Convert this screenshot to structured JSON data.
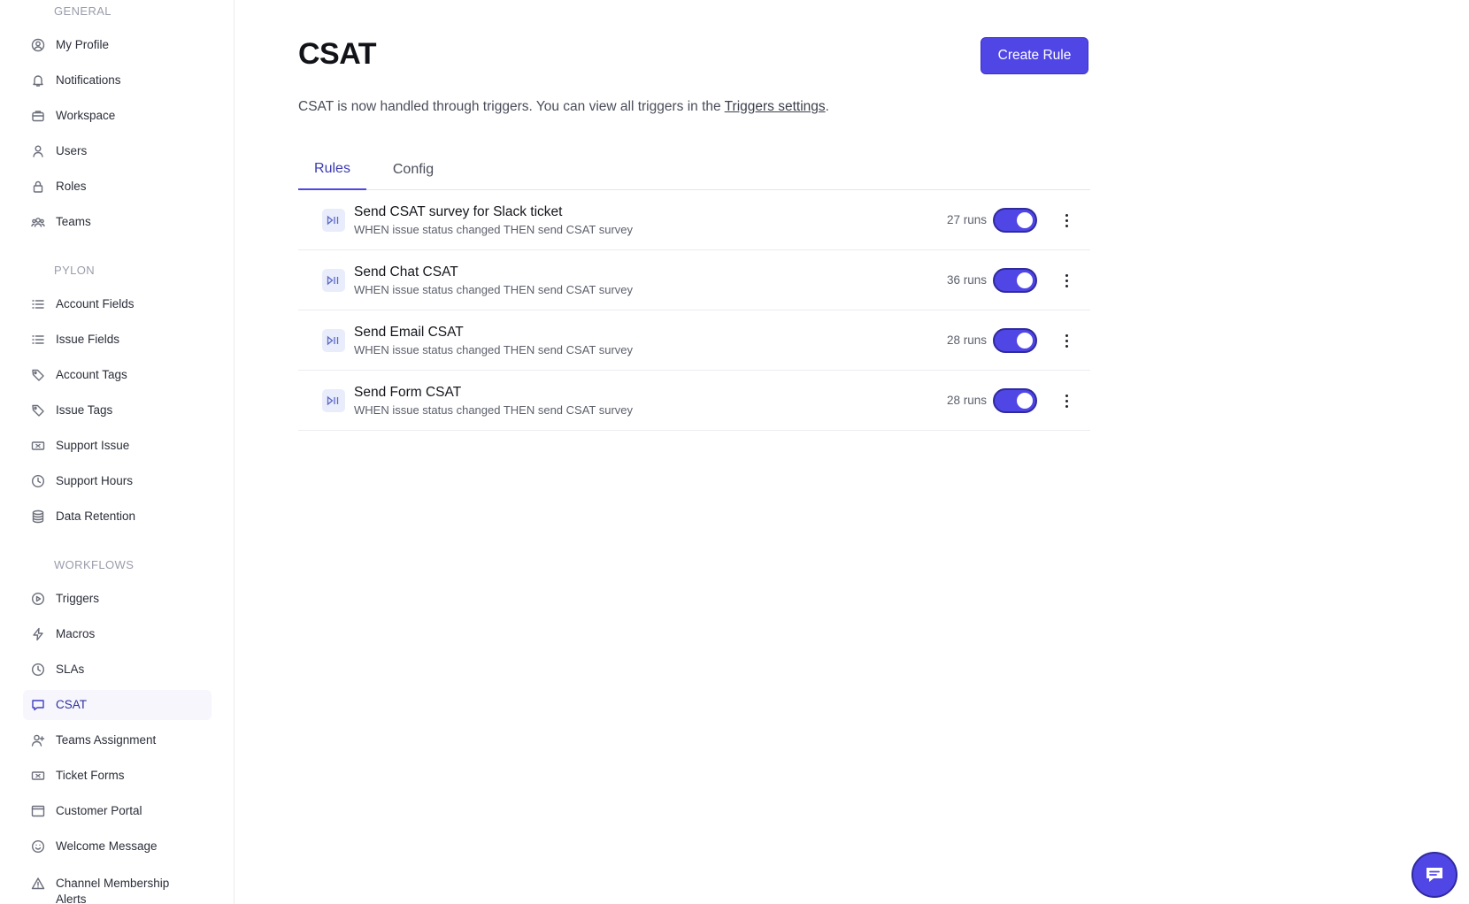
{
  "sidebar": {
    "sections": {
      "general": "GENERAL",
      "pylon": "PYLON",
      "workflows": "WORKFLOWS"
    },
    "items": [
      {
        "label": "My Profile",
        "icon": "user-circle-icon"
      },
      {
        "label": "Notifications",
        "icon": "bell-icon"
      },
      {
        "label": "Workspace",
        "icon": "briefcase-icon"
      },
      {
        "label": "Users",
        "icon": "user-icon"
      },
      {
        "label": "Roles",
        "icon": "lock-icon"
      },
      {
        "label": "Teams",
        "icon": "users-icon"
      },
      {
        "label": "Account Fields",
        "icon": "list-icon"
      },
      {
        "label": "Issue Fields",
        "icon": "list-icon"
      },
      {
        "label": "Account Tags",
        "icon": "tag-icon"
      },
      {
        "label": "Issue Tags",
        "icon": "tag-icon"
      },
      {
        "label": "Support Issue",
        "icon": "ticket-icon"
      },
      {
        "label": "Support Hours",
        "icon": "clock-icon"
      },
      {
        "label": "Data Retention",
        "icon": "database-icon"
      },
      {
        "label": "Triggers",
        "icon": "play-circle-icon"
      },
      {
        "label": "Macros",
        "icon": "bolt-icon"
      },
      {
        "label": "SLAs",
        "icon": "clock-icon"
      },
      {
        "label": "CSAT",
        "icon": "message-icon",
        "active": true
      },
      {
        "label": "Teams Assignment",
        "icon": "user-plus-icon"
      },
      {
        "label": "Ticket Forms",
        "icon": "ticket-icon"
      },
      {
        "label": "Customer Portal",
        "icon": "browser-icon"
      },
      {
        "label": "Welcome Message",
        "icon": "smile-icon"
      },
      {
        "label": "Channel Membership Alerts",
        "icon": "warning-icon"
      }
    ]
  },
  "main": {
    "title": "CSAT",
    "create_button": "Create Rule",
    "description_prefix": "CSAT is now handled through triggers. You can view all triggers in the ",
    "description_link": "Triggers settings",
    "description_suffix": ".",
    "tabs": [
      {
        "label": "Rules",
        "active": true
      },
      {
        "label": "Config",
        "active": false
      }
    ],
    "rules": [
      {
        "title": "Send CSAT survey for Slack ticket",
        "subtitle": "WHEN issue status changed THEN send CSAT survey",
        "runs": "27 runs",
        "enabled": true
      },
      {
        "title": "Send Chat CSAT",
        "subtitle": "WHEN issue status changed THEN send CSAT survey",
        "runs": "36 runs",
        "enabled": true
      },
      {
        "title": "Send Email CSAT",
        "subtitle": "WHEN issue status changed THEN send CSAT survey",
        "runs": "28 runs",
        "enabled": true
      },
      {
        "title": "Send Form CSAT",
        "subtitle": "WHEN issue status changed THEN send CSAT survey",
        "runs": "28 runs",
        "enabled": true
      }
    ]
  },
  "colors": {
    "accent": "#4f46e5",
    "active_nav_bg": "#f6f6fc"
  }
}
